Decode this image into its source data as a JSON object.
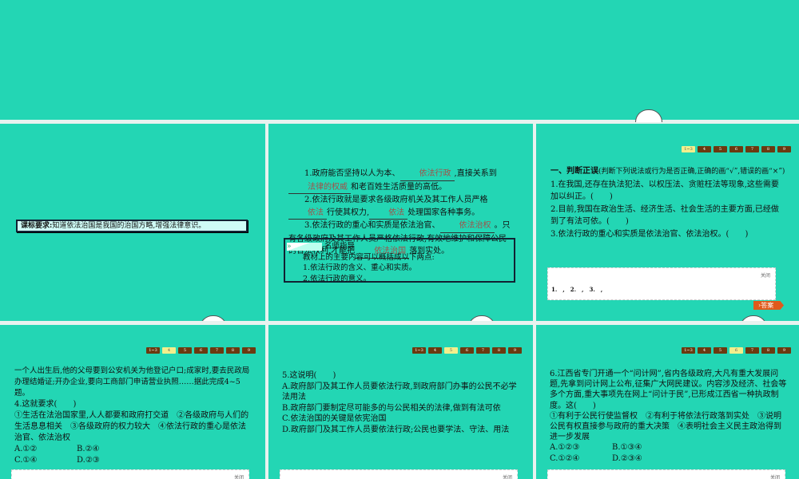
{
  "requirement": {
    "label": "课标要求:",
    "text": "知道依法治国是我国的治国方略,增强法律意识。"
  },
  "knowledge": {
    "l1a": "1.政府能否坚持以人为本、",
    "b1": "依法行政",
    "l1b": ",直接关系到",
    "b2": "法律的权威",
    "l1c": "和老百姓生活质量的高低。",
    "l2a": "2.依法行政就是要求各级政府机关及其工作人员严格",
    "b3": "依法",
    "l2b": "行使其权力,",
    "b4": "依法",
    "l2c": "处理国家各种事务。",
    "l3a": "3.依法行政的重心和实质是依法治官、",
    "b5": "依法治权",
    "l3b": "。只有各级政府及其工作人员严格依法行政,有效地维护和保障公民的合法权利,才能把",
    "b6": "依法治国",
    "l3c": "落到实处。"
  },
  "guide": {
    "title": "名师指导",
    "intro": "教材上的主要内容可以概括成以下两点:",
    "p1": "1.依法行政的含义、重心和实质。",
    "p2": "2.依法行政的意义。"
  },
  "pager": [
    "1~3",
    "4",
    "5",
    "6",
    "7",
    "8",
    "9"
  ],
  "judge": {
    "head": "一、判断正误",
    "note": "(判断下列说法或行为是否正确,正确的画“√”,错误的画“×”)",
    "q1": "1.在我国,还存在执法犯法、以权压法、贪赃枉法等现象,这些需要加以纠正。(　　)",
    "q2": "2.目前,我国在政治生活、经济生活、社会生活的主要方面,已经做到了有法可依。(　　)",
    "q3": "3.依法行政的重心和实质是依法治官、依法治权。(　　)",
    "answers": "1.　,　2.　,　3.　,",
    "close": "关闭",
    "answer_btn": "答案"
  },
  "q4": {
    "stem": "一个人出生后,他的父母要到公安机关为他登记户口;成家时,要去民政局办理结婚证;开办企业,要向工商部门申请营业执照……据此完成4~5题。",
    "q": "4.这就要求(　　)",
    "opts": "①生活在法治国家里,人人都要和政府打交道　②各级政府与人们的生活息息相关　③各级政府的权力较大　④依法行政的重心是依法治官、依法治权",
    "a": "A.①②",
    "b": "B.②④",
    "c": "C.①④",
    "d": "D.②③",
    "close": "关闭"
  },
  "q5": {
    "q": "5.这说明(　　)",
    "a": "A.政府部门及其工作人员要依法行政,到政府部门办事的公民不必学法用法",
    "b": "B.政府部门要制定尽可能多的与公民相关的法律,做到有法可依",
    "c": "C.依法治国的关键是依宪治国",
    "d": "D.政府部门及其工作人员要依法行政;公民也要学法、守法、用法",
    "close": "关闭"
  },
  "q6": {
    "q": "6.江西省专门开通一个“问计网”,省内各级政府,大凡有重大发展问题,先拿到问计网上公布,征集广大网民建议。内容涉及经济、社会等多个方面,重大事项先在网上“问计于民”,已形成江西省一种执政制度。这(　　)",
    "opts": "①有利于公民行使监督权　②有利于将依法行政落到实处　③说明公民有权直接参与政府的重大决策　④表明社会主义民主政治得到进一步发展",
    "a": "A.①②③",
    "b": "B.①③④",
    "c": "C.①②④",
    "d": "D.②③④",
    "close": "关闭"
  }
}
